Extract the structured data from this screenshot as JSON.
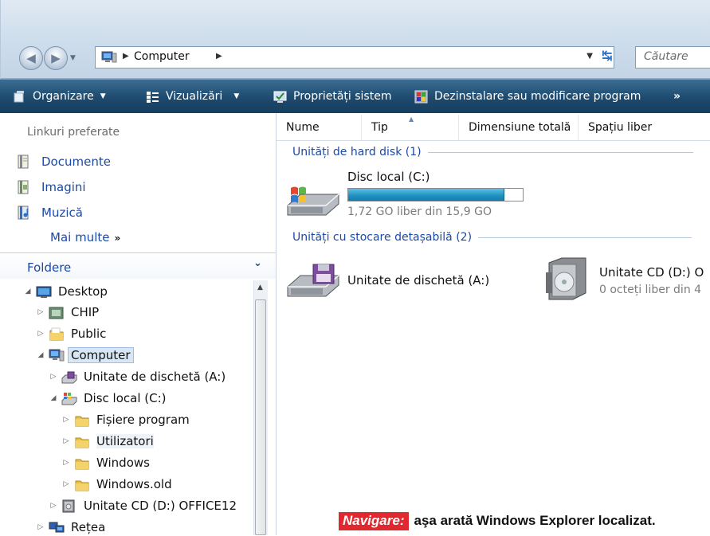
{
  "address_bar": {
    "path": "Computer",
    "search_placeholder": "Căutare"
  },
  "toolbar": {
    "organize": "Organizare",
    "views": "Vizualizări",
    "system_properties": "Proprietăți sistem",
    "uninstall": "Dezinstalare sau modificare program",
    "more": "»"
  },
  "favorites": {
    "title": "Linkuri preferate",
    "items": [
      {
        "label": "Documente",
        "icon": "documents-icon"
      },
      {
        "label": "Imagini",
        "icon": "pictures-icon"
      },
      {
        "label": "Muzică",
        "icon": "music-icon"
      }
    ],
    "more": "Mai multe",
    "more_glyph": "»"
  },
  "folders": {
    "title": "Foldere",
    "tree": [
      {
        "label": "Desktop",
        "icon": "desktop-icon",
        "expanded": true
      },
      {
        "label": "CHIP",
        "icon": "folder-icon"
      },
      {
        "label": "Public",
        "icon": "folder-icon"
      },
      {
        "label": "Computer",
        "icon": "computer-icon",
        "expanded": true,
        "selected": true
      },
      {
        "label": "Unitate de dischetă (A:)",
        "icon": "floppy-drive-icon"
      },
      {
        "label": "Disc local (C:)",
        "icon": "hard-disk-icon",
        "expanded": true
      },
      {
        "label": "Fișiere program",
        "icon": "folder-icon"
      },
      {
        "label": "Utilizatori",
        "icon": "folder-icon",
        "hover": true
      },
      {
        "label": "Windows",
        "icon": "folder-icon"
      },
      {
        "label": "Windows.old",
        "icon": "folder-icon"
      },
      {
        "label": "Unitate CD (D:) OFFICE12",
        "icon": "cd-drive-icon"
      },
      {
        "label": "Rețea",
        "icon": "network-icon"
      }
    ]
  },
  "columns": [
    "Nume",
    "Tip",
    "Dimensiune totală",
    "Spațiu liber"
  ],
  "groups": {
    "hard_disks": "Unități de hard disk (1)",
    "removable": "Unități cu stocare detașabilă (2)"
  },
  "drives": {
    "c": {
      "name": "Disc local (C:)",
      "free_text": "1,72 GO liber din 15,9 GO",
      "used_fraction": 0.89
    },
    "a": {
      "name": "Unitate de dischetă (A:)"
    },
    "d": {
      "name": "Unitate CD (D:) O",
      "free_text": "0 octeți liber din 4"
    }
  },
  "caption": {
    "tag": "Navigare:",
    "text": "aşa arată Windows Explorer localizat."
  },
  "colors": {
    "toolbar": "#1d4a6e",
    "link": "#1c49a8",
    "caption_tag": "#e0282e",
    "usage_fill": "#1f8fbf"
  }
}
